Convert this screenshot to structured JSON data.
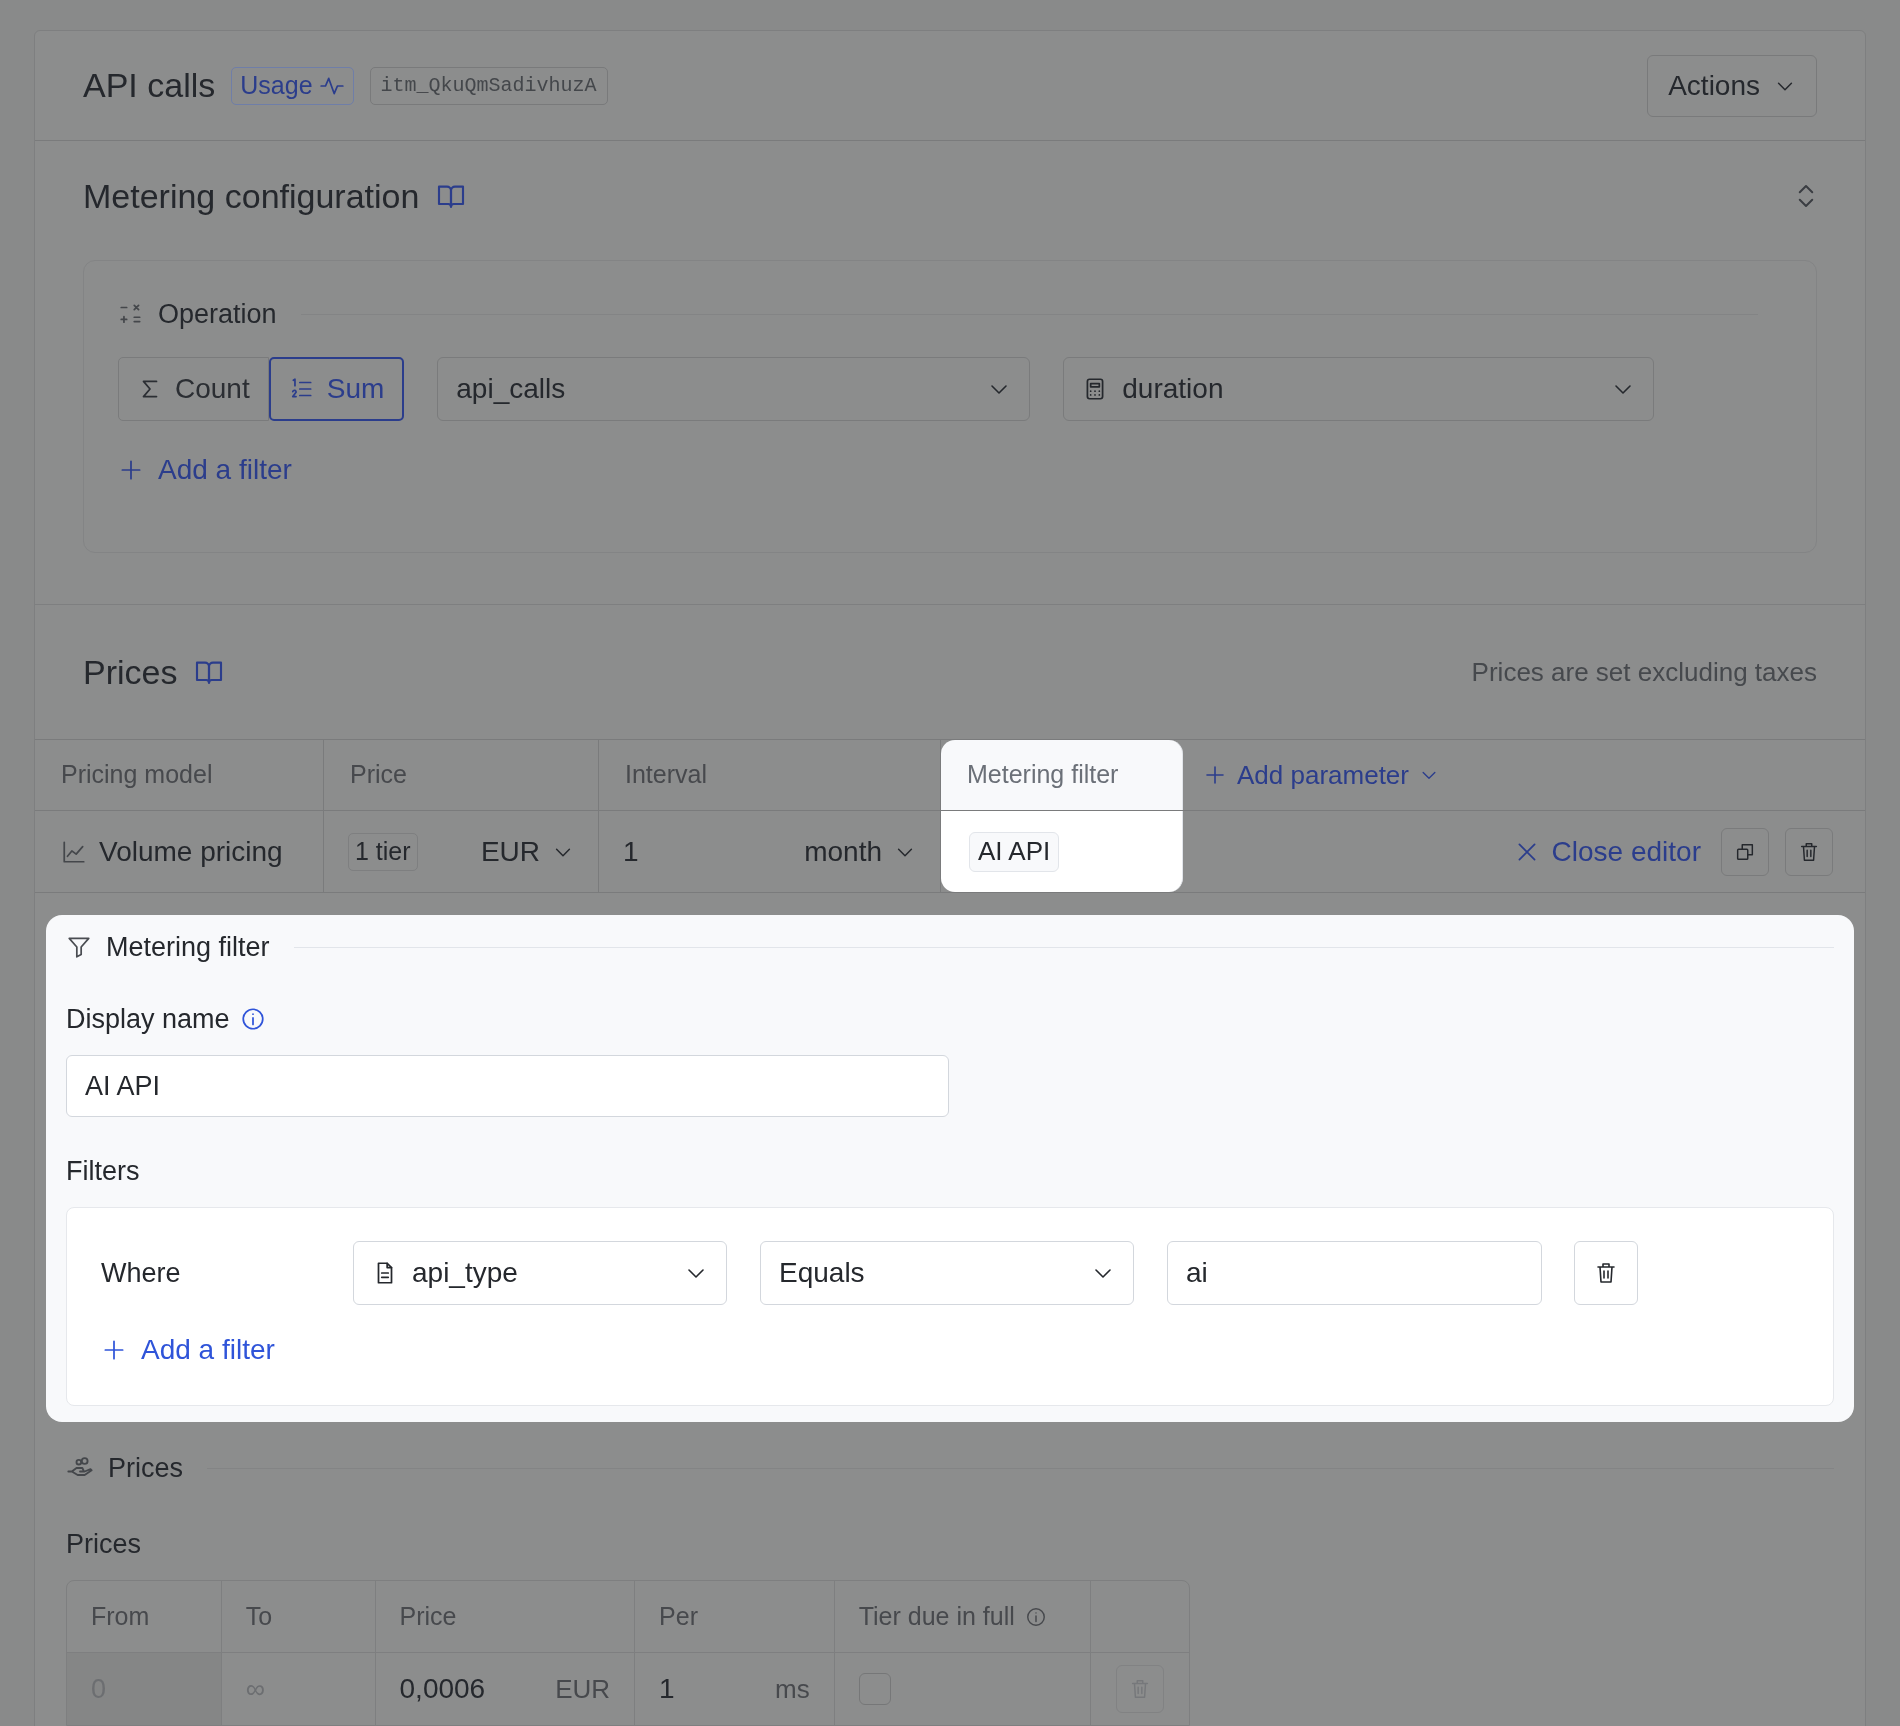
{
  "header": {
    "title": "API calls",
    "usage_badge": "Usage",
    "item_id": "itm_QkuQmSadivhuzA",
    "actions_button": "Actions"
  },
  "metering_configuration": {
    "title": "Metering configuration",
    "operation_label": "Operation",
    "operations": [
      {
        "label": "Count",
        "kind": "count",
        "selected": false
      },
      {
        "label": "Sum",
        "kind": "sum",
        "selected": true
      }
    ],
    "event_select": "api_calls",
    "property_select": "duration",
    "add_filter": "Add a filter"
  },
  "prices": {
    "title": "Prices",
    "note": "Prices are set excluding taxes",
    "columns": [
      "Pricing model",
      "Price",
      "Interval",
      "Metering filter"
    ],
    "add_parameter": "Add parameter",
    "row": {
      "pricing_model": "Volume pricing",
      "tiers": "1 tier",
      "currency": "EUR",
      "interval_count": "1",
      "interval_unit": "month",
      "metering_filter": "AI API",
      "close_editor": "Close editor"
    }
  },
  "metering_filter_panel": {
    "title": "Metering filter",
    "display_name_label": "Display name",
    "display_name_value": "AI API",
    "filters_label": "Filters",
    "filters": [
      {
        "conjunction": "Where",
        "field": "api_type",
        "operator": "Equals",
        "value": "ai"
      }
    ],
    "add_filter": "Add a filter"
  },
  "tier_prices": {
    "section_title": "Prices",
    "table_title": "Prices",
    "columns": [
      "From",
      "To",
      "Price",
      "Per",
      "Tier due in full"
    ],
    "rows": [
      {
        "from": "0",
        "to": "∞",
        "price": "0,0006",
        "currency": "EUR",
        "per": "1",
        "per_unit": "ms",
        "due_in_full": false
      }
    ]
  }
}
